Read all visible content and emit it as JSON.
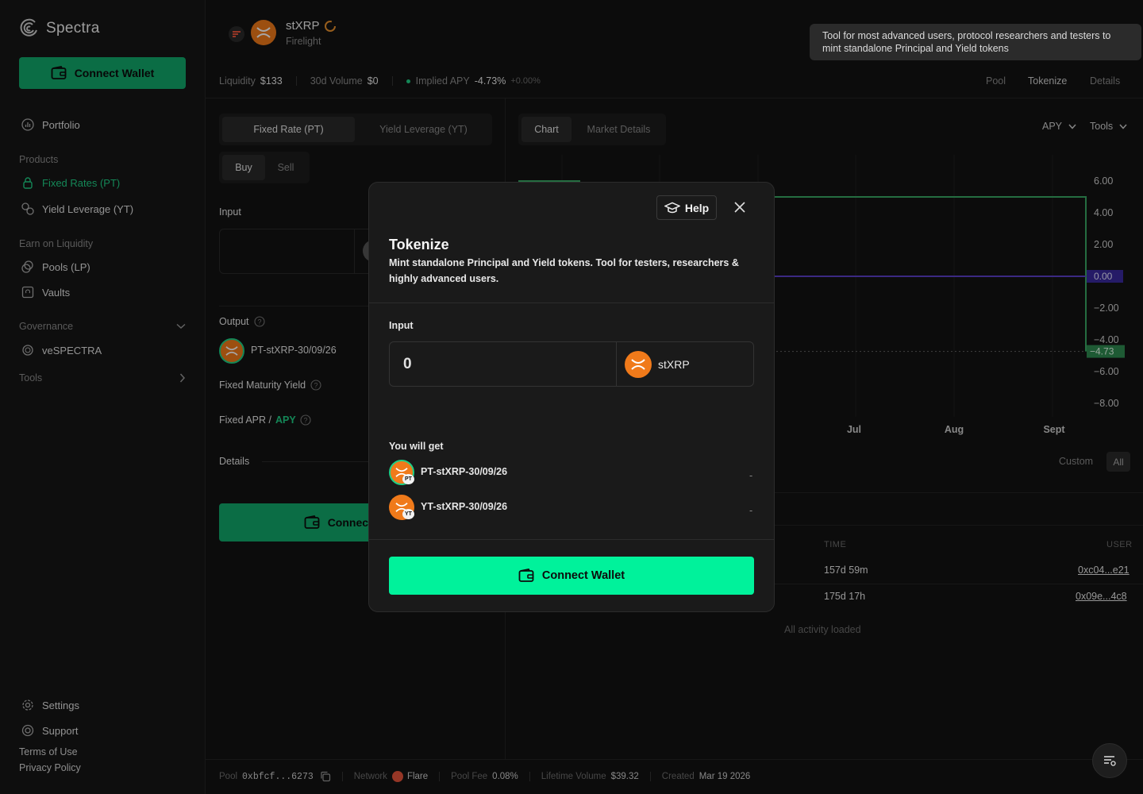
{
  "sidebar": {
    "logo": "Spectra",
    "connect_label": "Connect Wallet",
    "portfolio": "Portfolio",
    "products_title": "Products",
    "fixed_rates": "Fixed Rates (PT)",
    "yield_leverage": "Yield Leverage (YT)",
    "earn_title": "Earn on Liquidity",
    "pools": "Pools (LP)",
    "vaults": "Vaults",
    "governance_title": "Governance",
    "vespectra": "veSPECTRA",
    "tools": "Tools",
    "settings": "Settings",
    "support": "Support",
    "terms": "Terms of Use",
    "privacy": "Privacy Policy"
  },
  "header": {
    "asset": "stXRP",
    "protocol": "Firelight",
    "liquidity_label": "Liquidity",
    "liquidity_value": "$133",
    "volume_label": "30d Volume",
    "volume_value": "$0",
    "apy_label": "Implied APY",
    "apy_value": "-4.73%",
    "apy_change": "+0.00%",
    "nav": [
      "Pool",
      "Tokenize",
      "Details"
    ]
  },
  "tooltip": "Tool for most advanced users, protocol researchers and testers to mint standalone Principal and Yield tokens",
  "trade": {
    "tab_fixed": "Fixed Rate (PT)",
    "tab_yield": "Yield Leverage (YT)",
    "buy": "Buy",
    "sell": "Sell",
    "input_label": "Input",
    "output_label": "Output",
    "output_token": "PT-stXRP-30/09/26",
    "fixed_maturity": "Fixed Maturity Yield",
    "fixed_apr": "Fixed APR /",
    "apy": "APY",
    "details": "Details",
    "connect": "Connect Wallet"
  },
  "chart_panel": {
    "tab_chart": "Chart",
    "tab_market": "Market Details",
    "apy_select": "APY",
    "tools_select": "Tools",
    "custom": "Custom",
    "all": "All"
  },
  "chart_data": {
    "type": "line",
    "y_ticks": [
      "6.00",
      "4.00",
      "2.00",
      "0.00",
      "−2.00",
      "−4.00",
      "−6.00",
      "−8.00"
    ],
    "x_ticks": [
      "Jul",
      "Aug",
      "Sept"
    ],
    "ylim": [
      -9,
      7
    ],
    "current_label": "−4.73",
    "zero_label": "0.00",
    "series": [
      {
        "color": "#3aa864",
        "points": [
          [
            0,
            5
          ],
          [
            0.72,
            5
          ],
          [
            0.72,
            -4.73
          ]
        ]
      },
      {
        "color": "#5b3fc8",
        "points": [
          [
            0,
            0
          ],
          [
            0.72,
            0
          ]
        ]
      }
    ],
    "dotted_level": -4.73
  },
  "activity": {
    "col_time": "TIME",
    "col_user": "USER",
    "rows": [
      {
        "time": "157d 59m",
        "user": "0xc04...e21"
      },
      {
        "time": "175d 17h",
        "user": "0x09e...4c8"
      }
    ],
    "footer": "All activity loaded"
  },
  "modal": {
    "help": "Help",
    "title": "Tokenize",
    "subtitle": "Mint standalone Principal and Yield tokens. Tool for testers, researchers & highly advanced users.",
    "input_label": "Input",
    "input_value": "0",
    "token": "stXRP",
    "receive_title": "You will get",
    "pt_token": "PT-stXRP-30/09/26",
    "pt_badge": "PT",
    "yt_token": "YT-stXRP-30/09/26",
    "yt_badge": "YT",
    "pt_amount": "-",
    "yt_amount": "-",
    "connect": "Connect Wallet"
  },
  "footer": {
    "pool_label": "Pool",
    "pool_value": "0xbfcf...6273",
    "network_label": "Network",
    "network_value": "Flare",
    "fee_label": "Pool Fee",
    "fee_value": "0.08%",
    "lifetime_label": "Lifetime Volume",
    "lifetime_value": "$39.32",
    "created_label": "Created",
    "created_value": "Mar 19 2026"
  },
  "colors": {
    "accent": "#11a86b",
    "modal_button": "#00f29b",
    "token": "#f07a1a"
  }
}
